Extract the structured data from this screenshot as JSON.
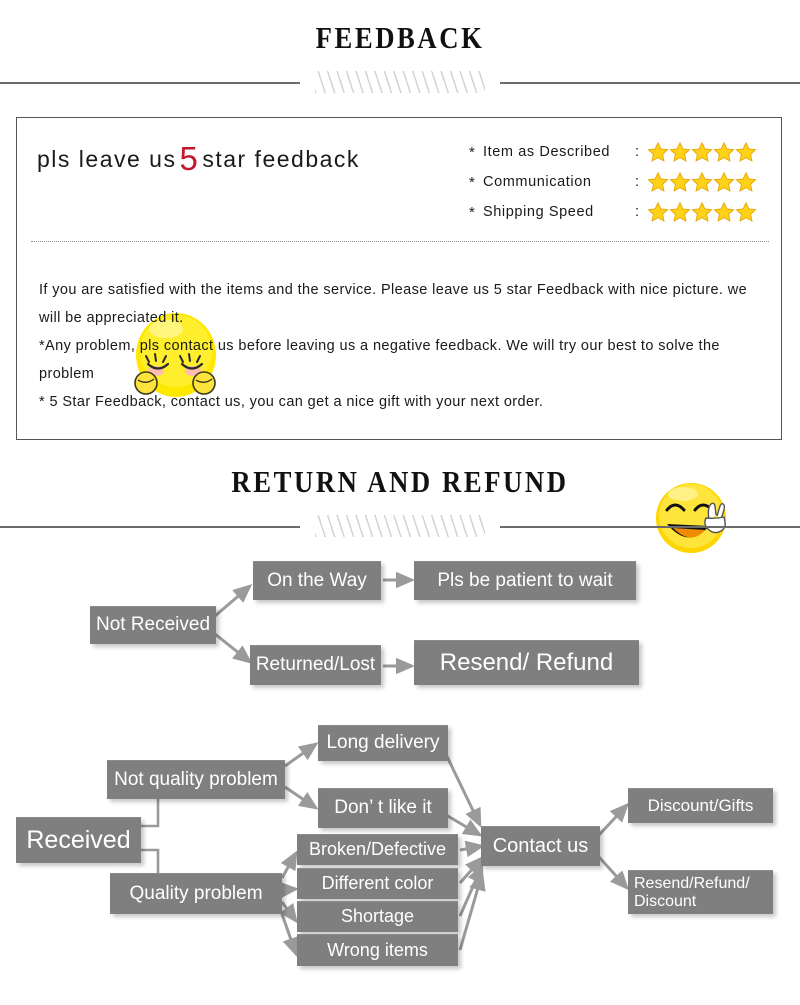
{
  "sections": [
    {
      "title": "FEEDBACK"
    },
    {
      "title": "RETURN AND REFUND"
    }
  ],
  "feedback": {
    "headline_prefix": "pls leave us",
    "headline_number": "5",
    "headline_suffix": "star feedback",
    "ratings": [
      {
        "bullet": "*",
        "label": "Item as Described",
        "colon": ":",
        "stars": 5
      },
      {
        "bullet": "*",
        "label": "Communication",
        "colon": ":",
        "stars": 5
      },
      {
        "bullet": "*",
        "label": "Shipping Speed",
        "colon": ":",
        "stars": 5
      }
    ],
    "star_color": "#FFD21A",
    "star_edge_color": "#E8A400",
    "lines": [
      "If you are satisfied with the items and the service. Please leave us 5 star Feedback with nice picture. we will be appreciated it.",
      "*Any problem, pls contact us before leaving us a negative feedback. We will try our best to solve  the problem",
      "* 5 Star Feedback, contact us, you can get a nice gift with your next order."
    ],
    "emoji_shy_name": "shy-blushing-face-emoji",
    "emoji_happy_name": "happy-peace-sign-face-emoji"
  },
  "flow": {
    "box_color": "#7f7f7f",
    "text_color": "#ffffff",
    "arrow_color": "#9a9a9a",
    "not_received": {
      "root": "Not Received",
      "branches": [
        {
          "cause": "On the Way",
          "result": "Pls be patient to wait"
        },
        {
          "cause": "Returned/Lost",
          "result": "Resend/ Refund"
        }
      ]
    },
    "received": {
      "root": "Received",
      "categories": [
        {
          "name": "Not quality problem",
          "reasons": [
            "Long delivery",
            "Don’ t like it"
          ]
        },
        {
          "name": "Quality problem",
          "reasons": [
            "Broken/Defective",
            "Different color",
            "Shortage",
            "Wrong items"
          ]
        }
      ],
      "hub": "Contact us",
      "outcomes": [
        "Discount/Gifts",
        "Resend/Refund/ Discount"
      ]
    }
  }
}
